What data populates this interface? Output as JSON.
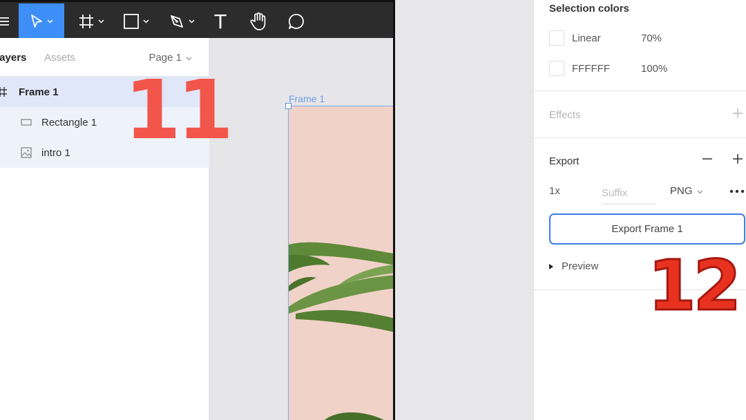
{
  "toolbar": {
    "tools": [
      {
        "name": "menu",
        "icon": "hamburger-menu-icon"
      },
      {
        "name": "move",
        "icon": "move-pointer-icon",
        "active": true
      },
      {
        "name": "frame",
        "icon": "frame-hash-icon"
      },
      {
        "name": "shape",
        "icon": "rectangle-shape-icon"
      },
      {
        "name": "pen",
        "icon": "pen-tool-icon"
      },
      {
        "name": "text",
        "icon": "text-tool-icon"
      },
      {
        "name": "hand",
        "icon": "hand-tool-icon"
      },
      {
        "name": "comment",
        "icon": "comment-bubble-icon"
      }
    ],
    "text_tool_glyph": "T",
    "accent_color": "#3e8ef7"
  },
  "layers_panel": {
    "tab_layers": "Layers",
    "tab_assets": "Assets",
    "page_selector": "Page 1",
    "layers": [
      {
        "label": "Frame 1",
        "type": "frame",
        "icon": "frame-hash-icon"
      },
      {
        "label": "Rectangle 1",
        "type": "rectangle",
        "icon": "rectangle-layer-icon"
      },
      {
        "label": "intro 1",
        "type": "image",
        "icon": "image-layer-icon"
      }
    ]
  },
  "canvas": {
    "frame_label": "Frame 1",
    "frame_fill": "#f1d2c8",
    "selection_color": "#7fa9ec"
  },
  "annotations": {
    "step_left": "11",
    "step_right": "12"
  },
  "properties_panel": {
    "selection_colors": {
      "title": "Selection colors",
      "items": [
        {
          "name": "Linear",
          "value": "70%"
        },
        {
          "name": "FFFFFF",
          "value": "100%"
        }
      ]
    },
    "effects": {
      "title": "Effects"
    },
    "export": {
      "title": "Export",
      "scale": "1x",
      "suffix_placeholder": "Suffix",
      "format": "PNG",
      "button_label": "Export Frame 1",
      "preview_label": "Preview"
    }
  }
}
